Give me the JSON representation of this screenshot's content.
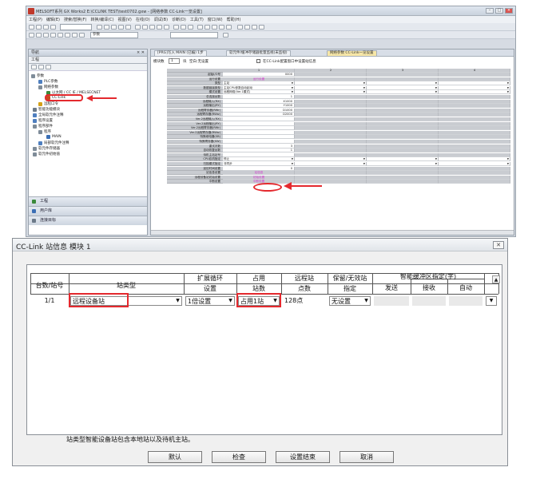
{
  "app": {
    "title": "MELSOFT系列 GX Works2 E:\\CCLINK TEST\\test0702.gxw - [网络参数 CC-Link一览设置]",
    "menu": [
      "工程(P)",
      "编辑(E)",
      "搜索/替换(F)",
      "转换/编译(C)",
      "视图(V)",
      "在线(O)",
      "调试(B)",
      "诊断(D)",
      "工具(T)",
      "窗口(W)",
      "帮助(H)"
    ],
    "toolbar_select1": "参数",
    "toolbar_select2": ""
  },
  "nav": {
    "header": "导航",
    "project_label": "工程",
    "tree": [
      "参数",
      "PLC参数",
      "网络参数",
      "以太网 / CC IE / MELSECNET",
      "CC-Link",
      "远程口令",
      "智能功能模块",
      "全局软元件注释",
      "程序设置",
      "程序部件",
      "程序",
      "MAIN",
      "局部软元件注释",
      "软元件存储器",
      "软元件初始值"
    ],
    "tabs": [
      "工程",
      "用户库",
      "连接目标"
    ]
  },
  "doc": {
    "tabs": [
      "[PRG]写入 MAIN (已编) 1步",
      "软元件/缓冲存储器批量监视(未监视)",
      "网络参数 CC-Link一览设置"
    ],
    "module_count_label": "模块数",
    "module_count_value": "1",
    "module_count_unit": "块",
    "blank_label": "空白:无设置",
    "checkbox_label": "在CC-Link配置窗口中设置站信息",
    "col_numbers": [
      "1",
      "2",
      "3",
      "4"
    ],
    "rows": [
      {
        "label": "起始I/O号",
        "v1": "0000"
      },
      {
        "label": "运行设置",
        "v1": "运行设置"
      },
      {
        "label": "类型",
        "v1": "主站"
      },
      {
        "label": "数据链接类型",
        "v1": "主站CPU参数自动起动"
      },
      {
        "label": "模式设置",
        "v1": "远程网络(Ver.1模式)"
      },
      {
        "label": "总连接台数",
        "v1": "1"
      },
      {
        "label": "远程输入(RX)",
        "v1": "X1000"
      },
      {
        "label": "远程输出(RY)",
        "v1": "Y1000"
      },
      {
        "label": "远程寄存器(RWr)",
        "v1": "D1000"
      },
      {
        "label": "远程寄存器(RWw)",
        "v1": "D2000"
      },
      {
        "label": "Ver.2远程输入(RX)",
        "v1": ""
      },
      {
        "label": "Ver.2远程输出(RY)",
        "v1": ""
      },
      {
        "label": "Ver.2远程寄存器(RWr)",
        "v1": ""
      },
      {
        "label": "Ver.2远程寄存器(RWw)",
        "v1": ""
      },
      {
        "label": "特殊继电器(SB)",
        "v1": ""
      },
      {
        "label": "特殊寄存器(SW)",
        "v1": ""
      },
      {
        "label": "重试次数",
        "v1": "3"
      },
      {
        "label": "自动恢复台数",
        "v1": "1"
      },
      {
        "label": "待机主站站号",
        "v1": ""
      },
      {
        "label": "CPU宕机指定",
        "v1": "停止"
      },
      {
        "label": "扫描模式指定",
        "v1": "非同步"
      },
      {
        "label": "延迟时间设置",
        "v1": "0"
      },
      {
        "label": "站信息设置",
        "v1": "站信息"
      },
      {
        "label": "远程设备站初始设置",
        "v1": "初始设置"
      },
      {
        "label": "中断设置",
        "v1": "中断设置"
      }
    ]
  },
  "dialog": {
    "title": "CC-Link 站信息 模块 1",
    "headers": {
      "station_no": "台数/站号",
      "station_type": "站类型",
      "expanded_cyclic_1": "扩展循环",
      "expanded_cyclic_2": "设置",
      "occupied_1": "占用",
      "occupied_2": "站数",
      "remote_points_1": "远程站",
      "remote_points_2": "点数",
      "reserved_1": "保留/无效站",
      "reserved_2": "指定",
      "buffer_group": "智能缓冲区指定(字)",
      "send": "发送",
      "receive": "接收",
      "auto": "自动"
    },
    "row": {
      "station_no": "1/1",
      "station_type": "远程设备站",
      "expanded_cyclic": "1倍设置",
      "occupied": "占用1站",
      "remote_points": "128点",
      "reserved": "无设置"
    },
    "footnote": "站类型智能设备站包含本地站以及待机主站。",
    "buttons": [
      "默认",
      "检查",
      "设置结束",
      "取消"
    ]
  }
}
